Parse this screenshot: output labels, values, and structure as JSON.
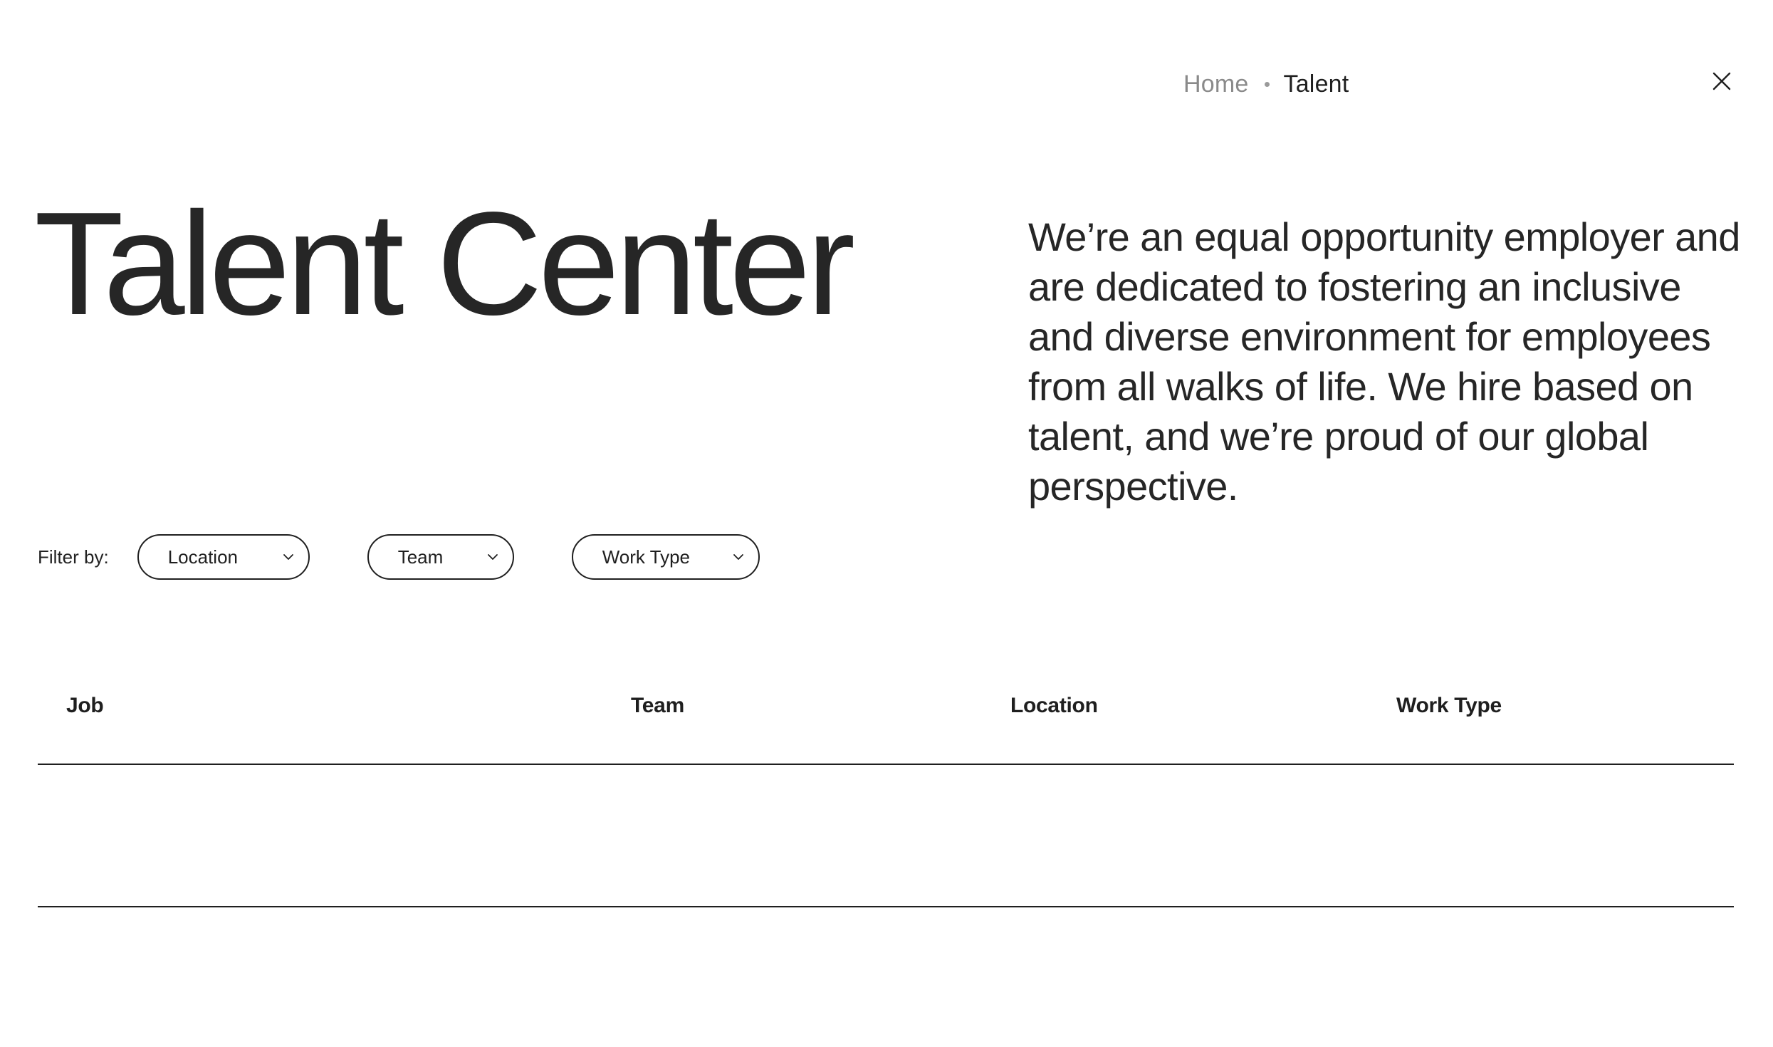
{
  "breadcrumb": {
    "home": "Home",
    "current": "Talent"
  },
  "close": {
    "icon": "close-icon"
  },
  "hero": {
    "title": "Talent Center",
    "intro": "We’re an equal opportunity employer and are dedicated to fostering an inclusive and diverse environment for employees from all walks of life. We hire based on talent, and we’re proud of our global perspective."
  },
  "filters": {
    "label": "Filter by:",
    "location": "Location",
    "team": "Team",
    "work_type": "Work Type"
  },
  "table": {
    "columns": [
      "Job",
      "Team",
      "Location",
      "Work Type"
    ],
    "rows": []
  },
  "colors": {
    "text": "#262626",
    "muted": "#8a8a8a",
    "border": "#1f1f1f",
    "background": "#ffffff"
  }
}
